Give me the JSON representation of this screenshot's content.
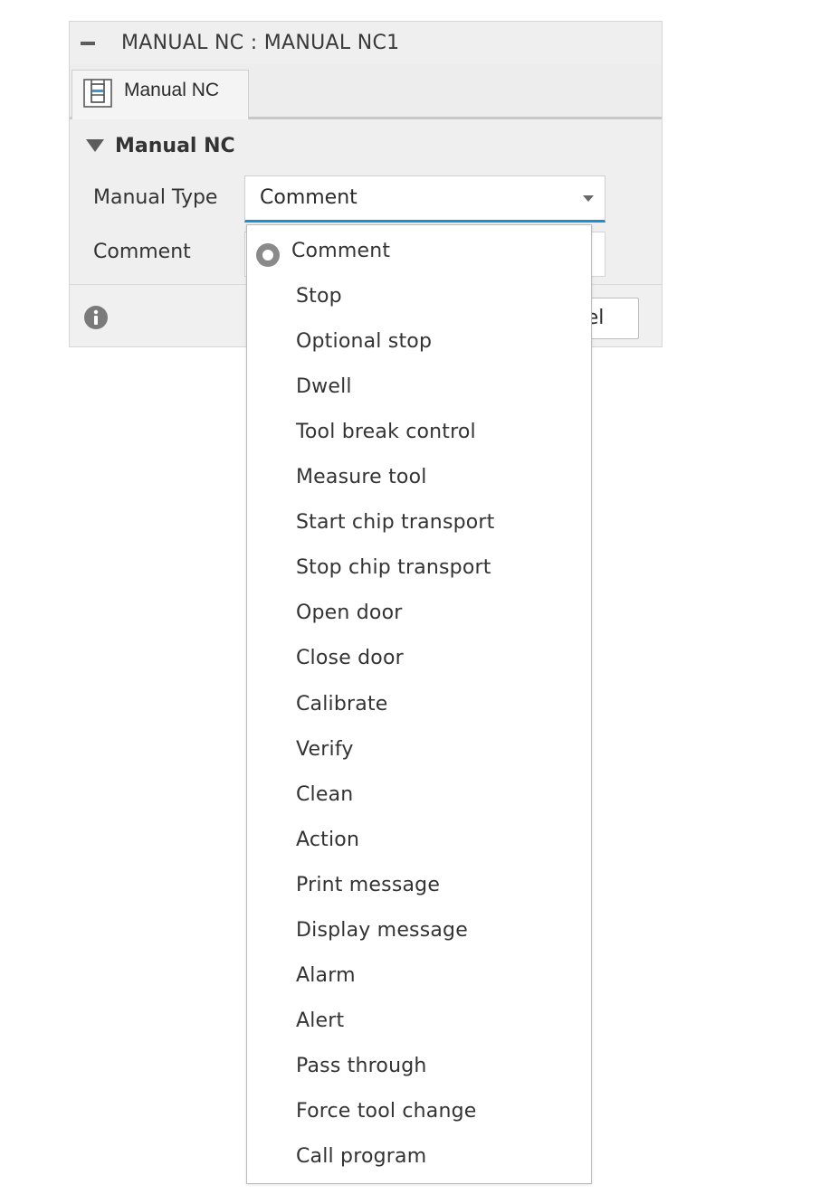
{
  "dialog": {
    "title": "MANUAL NC : MANUAL NC1",
    "tab_label": "Manual NC",
    "section_title": "Manual NC",
    "fields": {
      "manual_type_label": "Manual Type",
      "manual_type_value": "Comment",
      "comment_label": "Comment",
      "comment_value": ""
    },
    "footer": {
      "cancel_label_visible": "cel"
    }
  },
  "dropdown": {
    "selected": "Comment",
    "options": [
      "Comment",
      "Stop",
      "Optional stop",
      "Dwell",
      "Tool break control",
      "Measure tool",
      "Start chip transport",
      "Stop chip transport",
      "Open door",
      "Close door",
      "Calibrate",
      "Verify",
      "Clean",
      "Action",
      "Print message",
      "Display message",
      "Alarm",
      "Alert",
      "Pass through",
      "Force tool change",
      "Call program"
    ]
  },
  "colors": {
    "accent_underline": "#1a8fd6",
    "panel_bg": "#efefef",
    "radio": "#8a8a8a"
  },
  "icons": {
    "collapse": "minus-icon",
    "tab": "manual-nc-icon",
    "section_toggle": "triangle-down-icon",
    "select_arrow": "chevron-down-icon",
    "info": "info-icon",
    "selected_option": "radio-selected-icon"
  }
}
